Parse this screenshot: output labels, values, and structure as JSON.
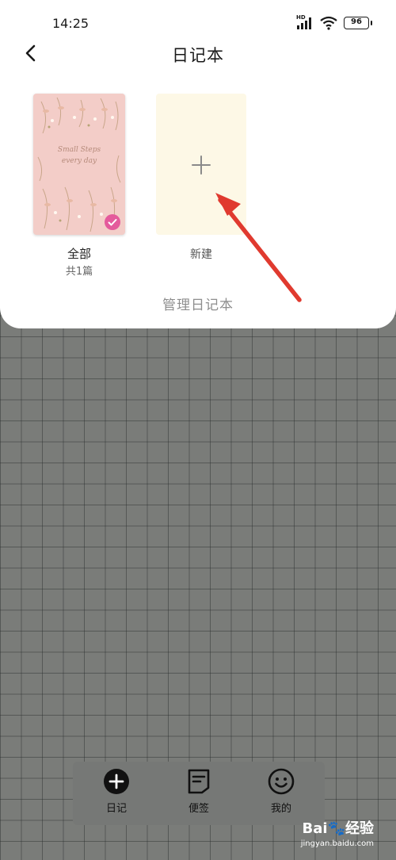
{
  "status_bar": {
    "time": "14:25",
    "network": "HD",
    "battery": "96"
  },
  "header": {
    "title": "日记本"
  },
  "notebooks": [
    {
      "label": "全部",
      "count": "共1篇",
      "cover_text_1": "Small Steps",
      "cover_text_2": "every day",
      "selected": true
    },
    {
      "label": "新建"
    }
  ],
  "manage": {
    "label": "管理日记本"
  },
  "tabbar": {
    "items": [
      {
        "label": "日记",
        "icon": "plus-circle-icon"
      },
      {
        "label": "便签",
        "icon": "note-icon"
      },
      {
        "label": "我的",
        "icon": "smiley-icon"
      }
    ]
  },
  "watermark": {
    "brand": "Bai",
    "brand_suffix": "经验",
    "url": "jingyan.baidu.com"
  },
  "colors": {
    "accent_pink": "#e45a9c",
    "arrow_red": "#e03a2f",
    "new_card_bg": "#fdf8e6",
    "cover_bg": "#f3cdc8"
  }
}
